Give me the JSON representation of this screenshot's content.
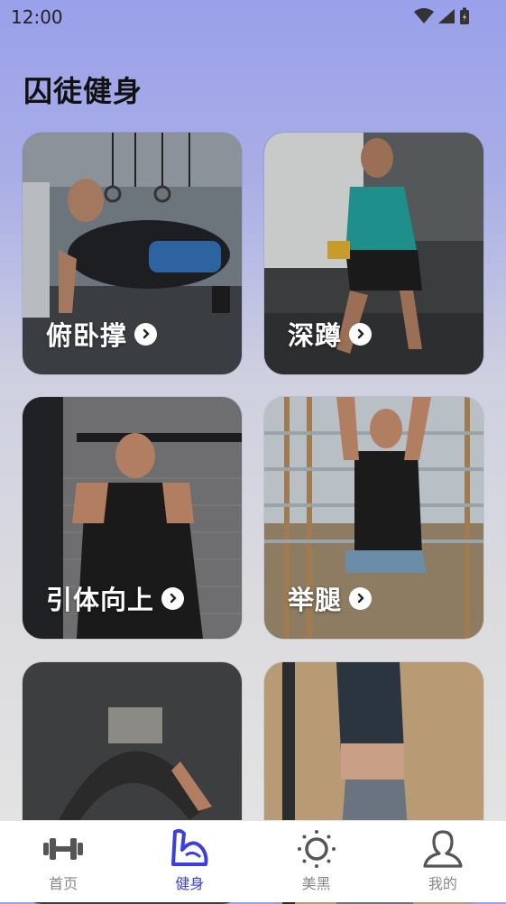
{
  "status": {
    "time": "12:00"
  },
  "page": {
    "title": "囚徒健身"
  },
  "exercises": [
    {
      "label": "俯卧撑"
    },
    {
      "label": "深蹲"
    },
    {
      "label": "引体向上"
    },
    {
      "label": "举腿"
    },
    {
      "label": ""
    },
    {
      "label": ""
    }
  ],
  "tabs": [
    {
      "label": "首页",
      "icon": "dumbbell-icon"
    },
    {
      "label": "健身",
      "icon": "arm-flex-icon",
      "active": true
    },
    {
      "label": "美黑",
      "icon": "sun-icon"
    },
    {
      "label": "我的",
      "icon": "person-icon"
    }
  ],
  "colors": {
    "accent": "#3b3fe0",
    "tab_inactive": "#555555"
  }
}
